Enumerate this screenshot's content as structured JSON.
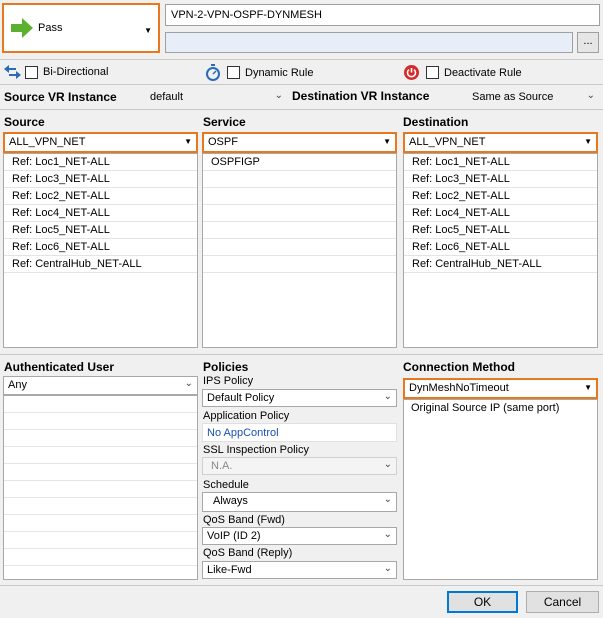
{
  "action": {
    "label": "Pass",
    "icon": "green-arrow-icon"
  },
  "rule": {
    "name": "VPN-2-VPN-OSPF-DYNMESH",
    "comment": "",
    "more_label": "..."
  },
  "options": {
    "bidirectional": {
      "label": "Bi-Directional",
      "checked": false
    },
    "dynamic_rule": {
      "label": "Dynamic Rule",
      "checked": false
    },
    "deactivate_rule": {
      "label": "Deactivate Rule",
      "checked": false
    }
  },
  "vr": {
    "source_label": "Source VR Instance",
    "source_value": "default",
    "dest_label": "Destination VR Instance",
    "dest_value": "Same as Source"
  },
  "source": {
    "header": "Source",
    "selected": "ALL_VPN_NET",
    "items": [
      "Ref: Loc1_NET-ALL",
      "Ref: Loc3_NET-ALL",
      "Ref: Loc2_NET-ALL",
      "Ref: Loc4_NET-ALL",
      "Ref: Loc5_NET-ALL",
      "Ref: Loc6_NET-ALL",
      "Ref: CentralHub_NET-ALL"
    ]
  },
  "service": {
    "header": "Service",
    "selected": "OSPF",
    "items": [
      "OSPFIGP"
    ]
  },
  "destination": {
    "header": "Destination",
    "selected": "ALL_VPN_NET",
    "items": [
      "Ref: Loc1_NET-ALL",
      "Ref: Loc3_NET-ALL",
      "Ref: Loc2_NET-ALL",
      "Ref: Loc4_NET-ALL",
      "Ref: Loc5_NET-ALL",
      "Ref: Loc6_NET-ALL",
      "Ref: CentralHub_NET-ALL"
    ]
  },
  "auth_user": {
    "header": "Authenticated User",
    "value": "Any"
  },
  "policies": {
    "header": "Policies",
    "ips_label": "IPS Policy",
    "ips_value": "Default Policy",
    "app_label": "Application Policy",
    "app_value": "No AppControl",
    "ssl_label": "SSL Inspection Policy",
    "ssl_value": "N.A.",
    "schedule_label": "Schedule",
    "schedule_value": "Always",
    "qos_fwd_label": "QoS Band (Fwd)",
    "qos_fwd_value": "VoIP (ID 2)",
    "qos_reply_label": "QoS Band (Reply)",
    "qos_reply_value": "Like-Fwd"
  },
  "connection": {
    "header": "Connection Method",
    "selected": "DynMeshNoTimeout",
    "items": [
      "Original Source IP (same port)"
    ]
  },
  "buttons": {
    "ok": "OK",
    "cancel": "Cancel"
  },
  "colors": {
    "accent": "#e8781e",
    "link": "#1a4fb4",
    "pass_green": "#5cb030"
  }
}
